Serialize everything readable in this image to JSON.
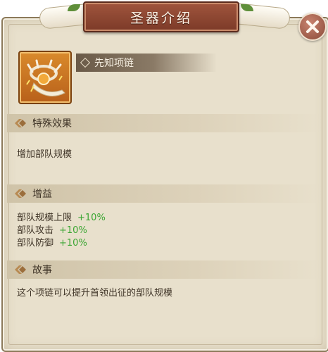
{
  "window": {
    "title": "圣器介绍"
  },
  "artifact": {
    "name": "先知项链"
  },
  "sections": {
    "special": {
      "header": "特殊效果",
      "body": "增加部队规模"
    },
    "buff": {
      "header": "增益",
      "stats": [
        {
          "label": "部队规模上限",
          "value": "+10%"
        },
        {
          "label": "部队攻击",
          "value": "+10%"
        },
        {
          "label": "部队防御",
          "value": "+10%"
        }
      ]
    },
    "story": {
      "header": "故事",
      "body": "这个项链可以提升首领出征的部队规模"
    }
  },
  "colors": {
    "positive": "#3aa532",
    "plaque": "#8c4430",
    "text": "#3e3326"
  },
  "icons": {
    "close": "close-icon",
    "section": "diamond-tag-icon"
  }
}
